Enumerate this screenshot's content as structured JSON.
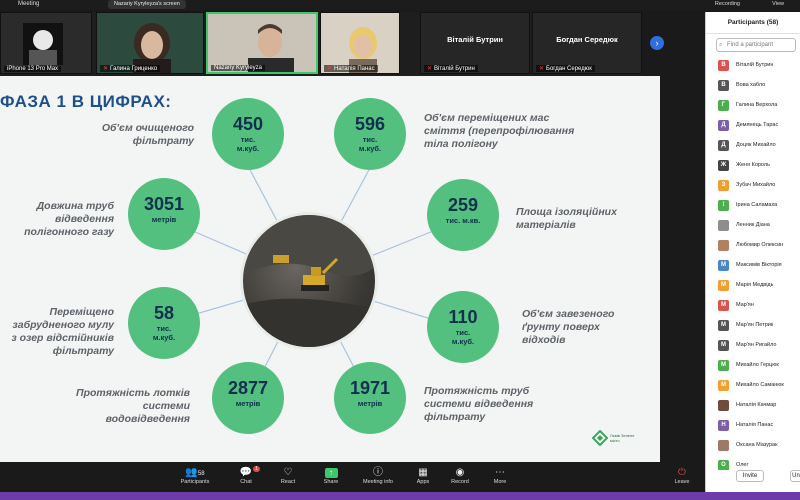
{
  "topbar": {
    "title": "Meeting",
    "share_label": "Nazariy Kyryleyza's screen",
    "recording": "Recording",
    "view": "View"
  },
  "strip": {
    "tiles": [
      {
        "name": "iPhone 13 Pro Max"
      },
      {
        "name": "Галина Гриценко"
      },
      {
        "name": "Nazariy Kyryleyza"
      },
      {
        "name": "Наталія Панас"
      },
      {
        "name": "Віталій Бутрин",
        "center": "Віталій Бутрин"
      },
      {
        "name": "Богдан Середюк",
        "center": "Богдан Середюк"
      }
    ]
  },
  "slide": {
    "title": "ФАЗА 1 В ЦИФРАХ:",
    "stats": [
      {
        "value": "450",
        "unit1": "тис.",
        "unit2": "м.куб.",
        "label": "Об'єм очищеного фільтрату"
      },
      {
        "value": "596",
        "unit1": "тис.",
        "unit2": "м.куб.",
        "label": "Об'єм переміщених мас сміття (перепрофілювання тіла полігону"
      },
      {
        "value": "3051",
        "unit1": "метрів",
        "unit2": "",
        "label": "Довжина труб відведення полігонного газу"
      },
      {
        "value": "259",
        "unit1": "тис.  м.кв.",
        "unit2": "",
        "label": "Площа ізоляційних матеріалів"
      },
      {
        "value": "58",
        "unit1": "тис.",
        "unit2": "м.куб.",
        "label": "Переміщено забрудненого мулу з озер відстійників фільтрату"
      },
      {
        "value": "110",
        "unit1": "тис.",
        "unit2": "м.куб.",
        "label": "Об'єм завезеного ґрунту поверх відходів"
      },
      {
        "value": "2877",
        "unit1": "метрів",
        "unit2": "",
        "label": "Протяжність лотків системи водовідведення"
      },
      {
        "value": "1971",
        "unit1": "метрів",
        "unit2": "",
        "label": "Протяжність труб системи відведення фільтрату"
      }
    ],
    "logo_text": "Львів Зелене місто"
  },
  "controls": {
    "participants_label": "Participants",
    "participants_count": "58",
    "chat_label": "Chat",
    "chat_badge": "1",
    "react_label": "React",
    "share_label": "Share",
    "meeting_info_label": "Meeting info",
    "apps_label": "Apps",
    "record_label": "Record",
    "more_label": "More",
    "leave_label": "Leave"
  },
  "panel": {
    "header": "Participants (58)",
    "search_placeholder": "Find a participant",
    "participants": [
      {
        "initial": "В",
        "name": "Віталій Бутрин",
        "color": "#d9534f"
      },
      {
        "initial": "В",
        "name": "Вова хабло",
        "color": "#555555"
      },
      {
        "initial": "Г",
        "name": "Галина Верхола",
        "color": "#4cae4c"
      },
      {
        "initial": "Д",
        "name": "Демянець Тарас",
        "color": "#7b5ea7"
      },
      {
        "initial": "Д",
        "name": "Доцяк Михайло",
        "color": "#555555"
      },
      {
        "initial": "Ж",
        "name": "Женя Король",
        "color": "#444444"
      },
      {
        "initial": "З",
        "name": "Зубач  Михайло",
        "color": "#f0a030"
      },
      {
        "initial": "І",
        "name": "Ірина Саламаха",
        "color": "#4cae4c"
      },
      {
        "initial": "",
        "name": "Ленник Діана",
        "color": "#8e8e8e"
      },
      {
        "initial": "",
        "name": "Любомир Олексин",
        "color": "#b08060"
      },
      {
        "initial": "М",
        "name": "Максимів Вікторія",
        "color": "#4a86c8"
      },
      {
        "initial": "М",
        "name": "Марія Медвідь",
        "color": "#f0a030"
      },
      {
        "initial": "М",
        "name": "Мар'ян",
        "color": "#d9534f"
      },
      {
        "initial": "М",
        "name": "Мар'ян Петрик",
        "color": "#555555"
      },
      {
        "initial": "М",
        "name": "Мар'ян Ригайло",
        "color": "#555555"
      },
      {
        "initial": "М",
        "name": "Михайло Герцюк",
        "color": "#4cae4c"
      },
      {
        "initial": "М",
        "name": "Михайло Саманюк",
        "color": "#f0a030"
      },
      {
        "initial": "",
        "name": "Наталія Качмар",
        "color": "#6e4b3a"
      },
      {
        "initial": "Н",
        "name": "Наталія Панас",
        "color": "#7b5ea7"
      },
      {
        "initial": "",
        "name": "Оксана Мазурак",
        "color": "#a07868"
      },
      {
        "initial": "О",
        "name": "Олег",
        "color": "#4cae4c"
      }
    ],
    "invite_label": "Invite",
    "unmute_label": "Un"
  }
}
